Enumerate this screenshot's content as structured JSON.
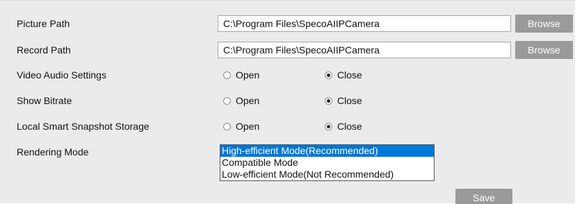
{
  "settings": {
    "picture_path": {
      "label": "Picture Path",
      "value": "C:\\Program Files\\SpecoAIIPCamera",
      "button": "Browse"
    },
    "record_path": {
      "label": "Record Path",
      "value": "C:\\Program Files\\SpecoAIIPCamera",
      "button": "Browse"
    },
    "video_audio": {
      "label": "Video Audio Settings",
      "open": "Open",
      "close": "Close",
      "selected": "Close"
    },
    "show_bitrate": {
      "label": "Show Bitrate",
      "open": "Open",
      "close": "Close",
      "selected": "Close"
    },
    "snapshot_storage": {
      "label": "Local Smart Snapshot Storage",
      "open": "Open",
      "close": "Close",
      "selected": "Close"
    },
    "rendering_mode": {
      "label": "Rendering Mode",
      "options": [
        "High-efficient Mode(Recommended)",
        "Compatible Mode",
        "Low-efficient Mode(Not Recommended)"
      ],
      "selected": "High-efficient Mode(Recommended)"
    }
  },
  "save_label": "Save"
}
